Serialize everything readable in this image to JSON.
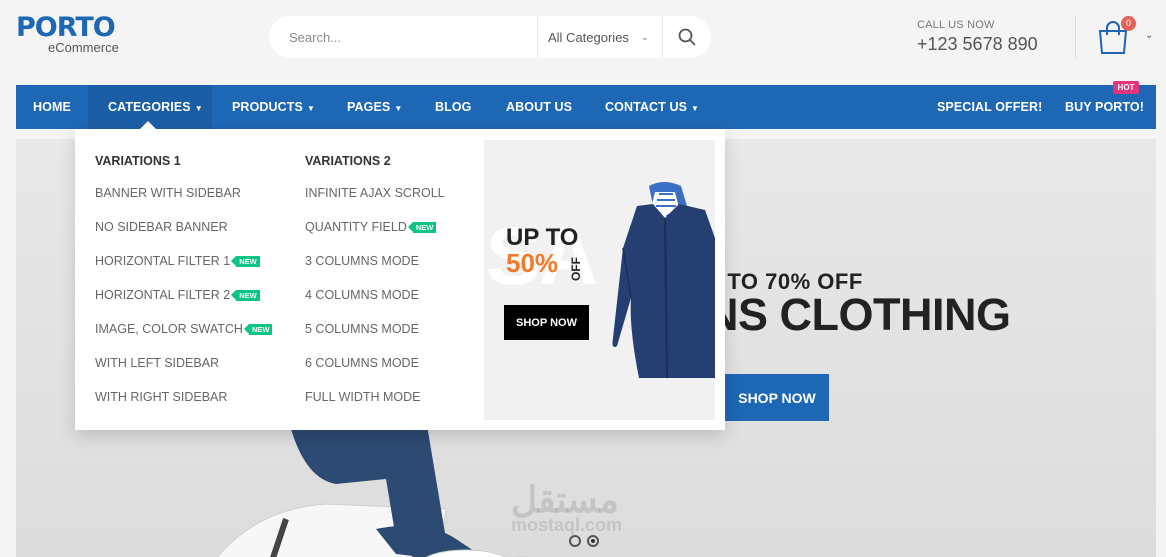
{
  "logo": {
    "name": "PORTO",
    "sub": "eCommerce"
  },
  "search": {
    "placeholder": "Search...",
    "category": "All Categories"
  },
  "contact": {
    "label": "CALL US NOW",
    "phone": "+123 5678 890"
  },
  "cart": {
    "count": "0"
  },
  "nav": {
    "items": [
      {
        "label": "HOME"
      },
      {
        "label": "CATEGORIES"
      },
      {
        "label": "PRODUCTS"
      },
      {
        "label": "PAGES"
      },
      {
        "label": "BLOG"
      },
      {
        "label": "ABOUT US"
      },
      {
        "label": "CONTACT US"
      }
    ],
    "special_offer": "SPECIAL OFFER!",
    "buy": "BUY PORTO!",
    "hot_badge": "HOT"
  },
  "dropdown": {
    "col1": {
      "title": "VARIATIONS 1",
      "items": [
        "BANNER WITH SIDEBAR",
        "NO SIDEBAR BANNER",
        "HORIZONTAL FILTER 1",
        "HORIZONTAL FILTER 2",
        "IMAGE, COLOR SWATCH",
        "WITH LEFT SIDEBAR",
        "WITH RIGHT SIDEBAR"
      ]
    },
    "col2": {
      "title": "VARIATIONS 2",
      "items": [
        "INFINITE AJAX SCROLL",
        "QUANTITY FIELD",
        "3 COLUMNS MODE",
        "4 COLUMNS MODE",
        "5 COLUMNS MODE",
        "6 COLUMNS MODE",
        "FULL WIDTH MODE"
      ]
    },
    "new_badge": "NEW",
    "promo": {
      "bg_text": "SA",
      "up_to": "UP TO",
      "percent": "50%",
      "off": "OFF",
      "button": "SHOP NOW"
    }
  },
  "hero": {
    "line1": "P TO 70% OFF",
    "line2": "NS CLOTHING",
    "button": "SHOP NOW"
  },
  "watermark": {
    "text": "مستقل",
    "sub": "mostaql.com"
  },
  "colors": {
    "brand": "#1d67b5",
    "new": "#0cc485",
    "hot": "#e3347d",
    "promo_pct": "#f07b2c"
  }
}
